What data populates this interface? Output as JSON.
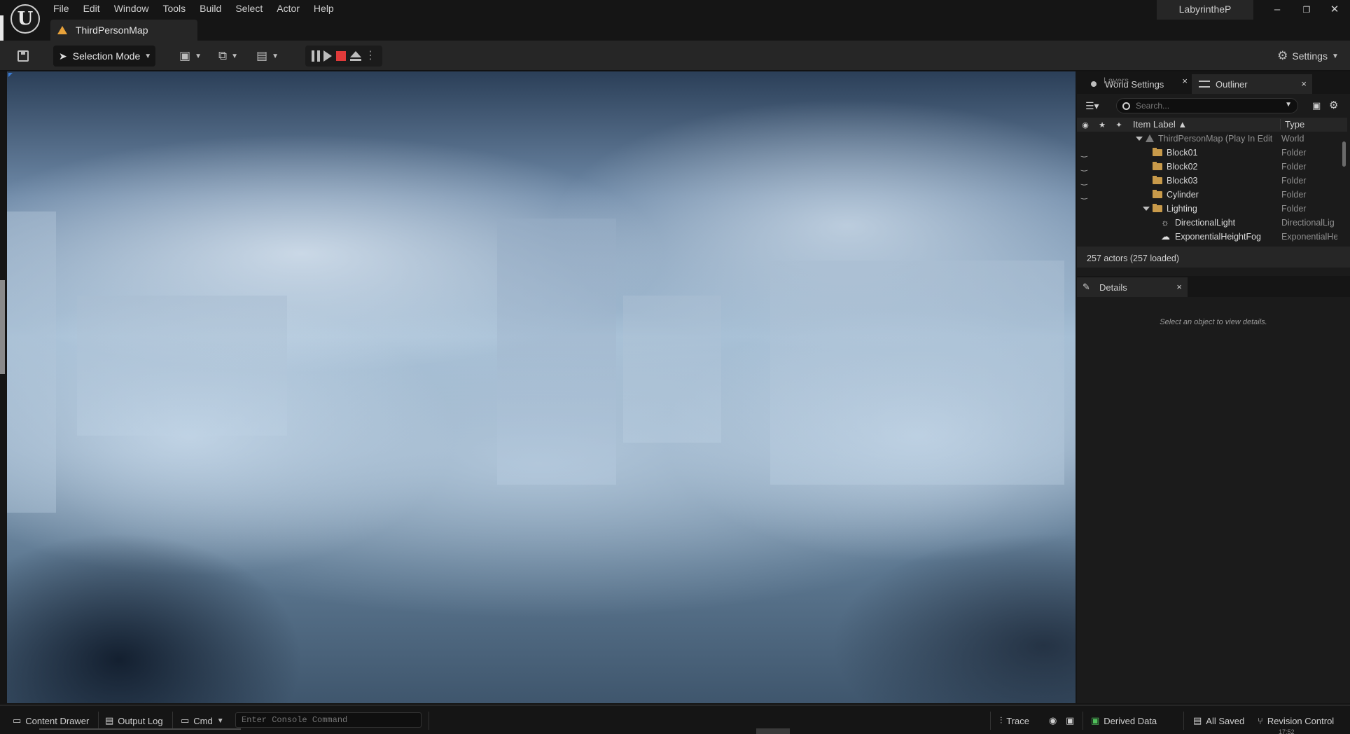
{
  "menu": [
    "File",
    "Edit",
    "Window",
    "Tools",
    "Build",
    "Select",
    "Actor",
    "Help"
  ],
  "project_name": "LabyrintheP",
  "window_controls": {
    "minimize": "–",
    "restore": "❐",
    "close": "✕"
  },
  "map_tab": {
    "label": "ThirdPersonMap",
    "icon": "warning-icon"
  },
  "toolbar": {
    "selection_mode": "Selection Mode",
    "settings": "Settings"
  },
  "dock": {
    "tab_layers_ghost": "Layers",
    "tab_world_settings": "World Settings",
    "tab_outliner": "Outliner",
    "search_placeholder": "Search...",
    "col_item_label": "Item Label ▲",
    "col_type": "Type",
    "rows": [
      {
        "label": "ThirdPersonMap (Play In Edit",
        "type": "World"
      },
      {
        "label": "Block01",
        "type": "Folder"
      },
      {
        "label": "Block02",
        "type": "Folder"
      },
      {
        "label": "Block03",
        "type": "Folder"
      },
      {
        "label": "Cylinder",
        "type": "Folder"
      },
      {
        "label": "Lighting",
        "type": "Folder"
      },
      {
        "label": "DirectionalLight",
        "type": "DirectionalLig"
      },
      {
        "label": "ExponentialHeightFog",
        "type": "ExponentialHe"
      }
    ],
    "actor_count": "257 actors (257 loaded)",
    "details_tab": "Details",
    "details_empty": "Select an object to view details."
  },
  "statusbar": {
    "content_drawer": "Content Drawer",
    "output_log": "Output Log",
    "cmd": "Cmd",
    "console_placeholder": "Enter Console Command",
    "trace": "Trace",
    "derived_data": "Derived Data",
    "all_saved": "All Saved",
    "revision_control": "Revision Control",
    "clock": "17:52"
  },
  "colors": {
    "accent_blue": "#3a7bd5",
    "stop_red": "#e03a3a",
    "folder": "#c89a4a",
    "warning": "#e8a23a"
  }
}
